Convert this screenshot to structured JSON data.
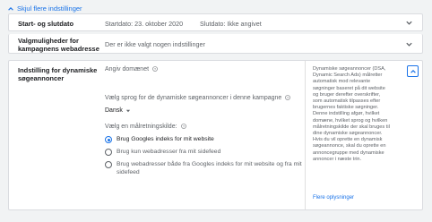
{
  "toggle": {
    "label": "Skjul flere indstillinger"
  },
  "rows": [
    {
      "label": "Start- og slutdato",
      "start": "Startdato: 23. oktober 2020",
      "end": "Slutdato: Ikke angivet"
    },
    {
      "label_line1": "Valgmuligheder for",
      "label_line2": "kampagnens webadresse",
      "value": "Der er ikke valgt nogen indstillinger"
    }
  ],
  "dsa": {
    "title_line1": "Indstilling for dynamiske",
    "title_line2": "søgeannoncer",
    "domain_label": "Angiv domænet",
    "language_label": "Vælg sprog for de dynamiske søgeannoncer i denne kampagne",
    "language_value": "Dansk",
    "source_label": "Vælg en målretningskilde:",
    "options": [
      {
        "label": "Brug Googles indeks for mit website",
        "selected": true
      },
      {
        "label": "Brug kun webadresser fra mit sidefeed",
        "selected": false
      },
      {
        "label_line1": "Brug webadresser både fra Googles indeks for mit website og fra mit",
        "label_line2": "sidefeed",
        "selected": false
      }
    ],
    "help_text": "Dynamiske søgeannoncer (DSA, Dynamic Search Ads) målretter automatisk mod relevante søgninger baseret på dit website og bruger derefter overskrifter, som automatisk tilpasses efter brugernes faktiske søgninger. Denne indstilling afgør, hvilket domæne, hvilket sprog og hvilken målretningskilde der skal bruges til dine dynamiske søgeannoncer. Hvis du vil oprette en dynamisk søgeannonce, skal du oprette en annoncegruppe med dynamiske annoncer i næste trin.",
    "learn_more": "Flere oplysninger"
  },
  "colors": {
    "accent": "#1a73e8",
    "text": "#202124",
    "muted": "#5f6368"
  }
}
